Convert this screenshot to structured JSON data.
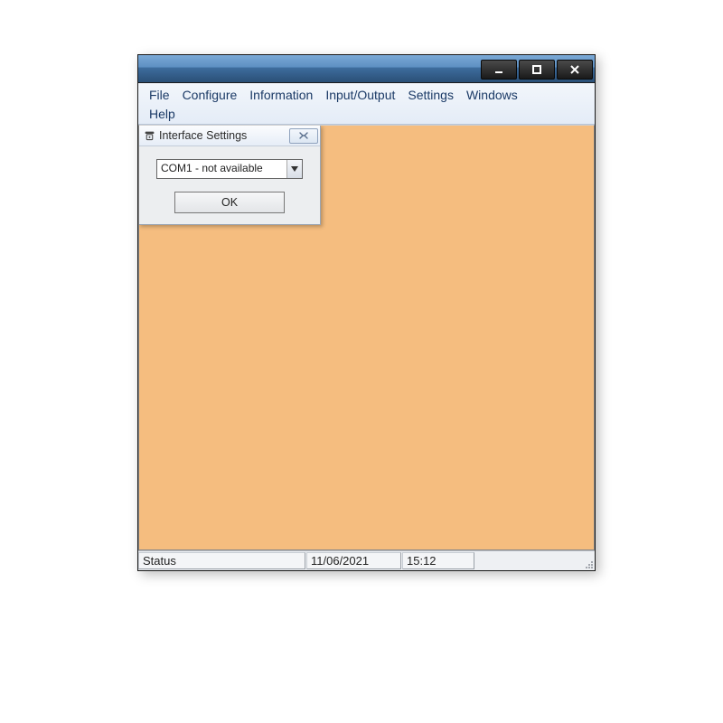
{
  "menubar": {
    "items": [
      "File",
      "Configure",
      "Information",
      "Input/Output",
      "Settings",
      "Windows",
      "Help"
    ]
  },
  "dialog": {
    "title": "Interface Settings",
    "combo_value": "COM1 - not available",
    "ok_label": "OK"
  },
  "statusbar": {
    "status": "Status",
    "date": "11/06/2021",
    "time": "15:12"
  }
}
